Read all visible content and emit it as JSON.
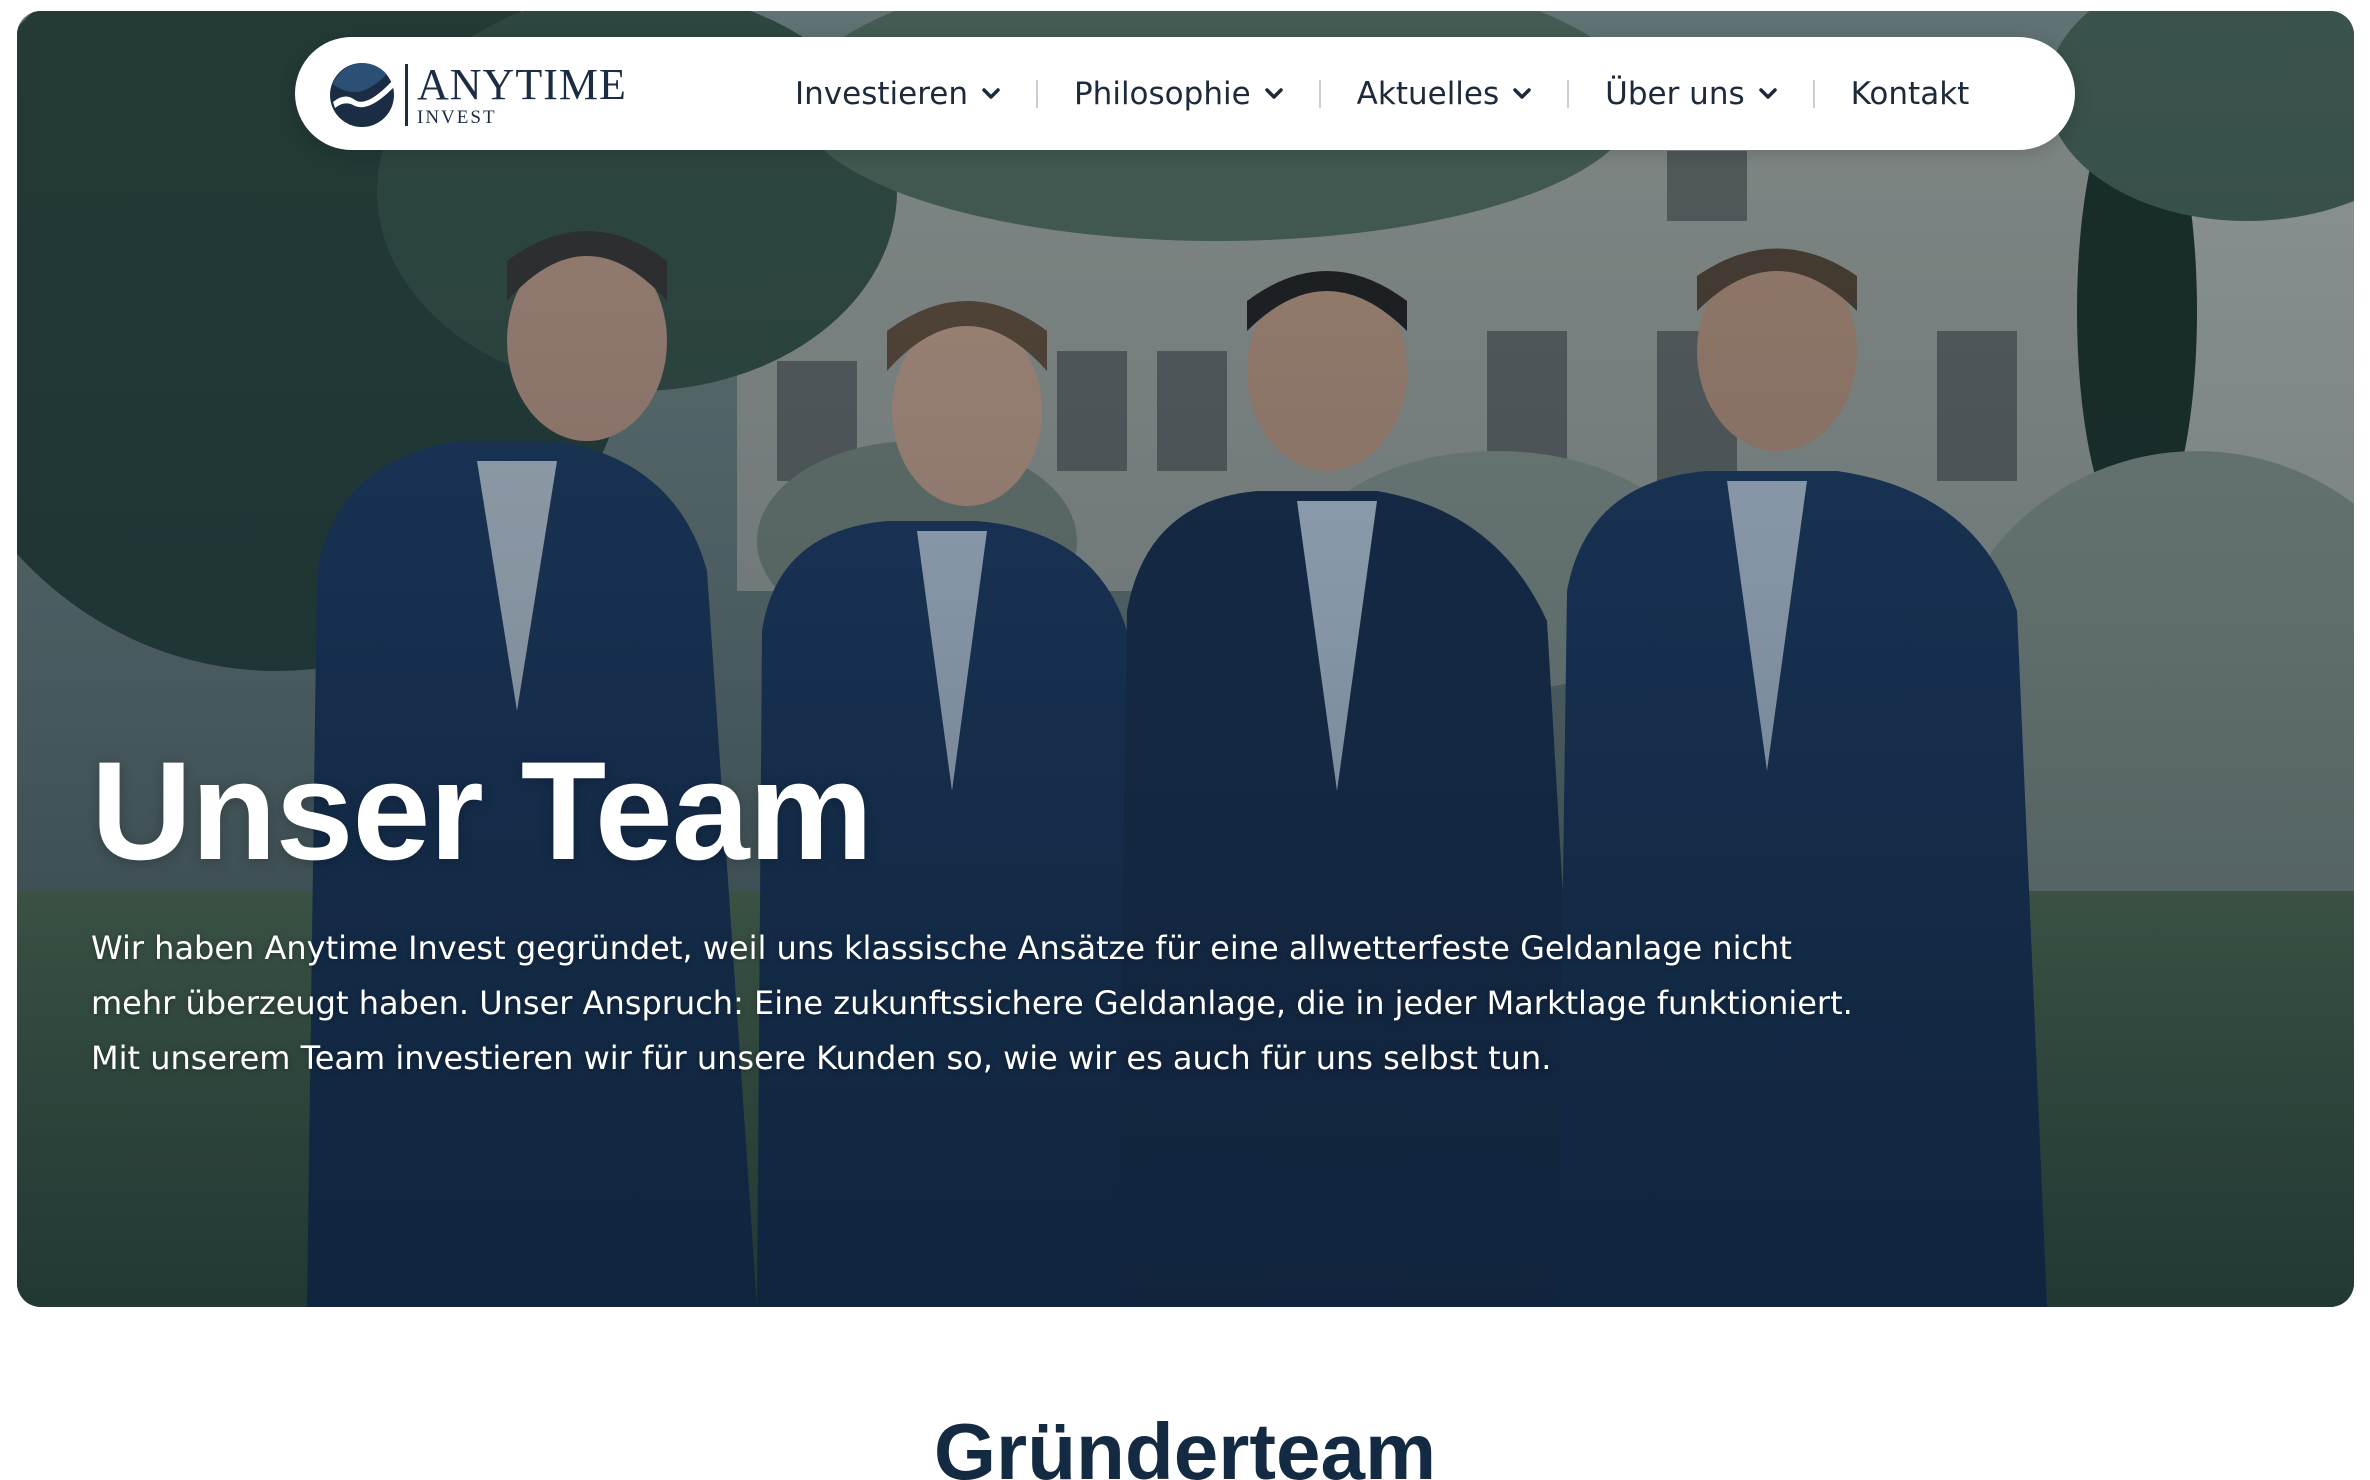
{
  "brand": {
    "name": "ANYTIME",
    "sub": "INVEST",
    "colors": {
      "navy": "#1b2d44",
      "accent": "#2f6fae"
    }
  },
  "nav": {
    "items": [
      {
        "label": "Investieren",
        "has_dropdown": true,
        "icon": "chevron-down-icon"
      },
      {
        "label": "Philosophie",
        "has_dropdown": true,
        "icon": "chevron-down-icon"
      },
      {
        "label": "Aktuelles",
        "has_dropdown": true,
        "icon": "chevron-down-icon"
      },
      {
        "label": "Über uns",
        "has_dropdown": true,
        "icon": "chevron-down-icon"
      },
      {
        "label": "Kontakt",
        "has_dropdown": false
      }
    ]
  },
  "hero": {
    "title": "Unser Team",
    "text": "Wir haben Anytime Invest gegründet, weil uns klassische Ansätze für eine allwetterfeste Geldanlage nicht mehr überzeugt haben. Unser Anspruch: Eine zukunftssichere Geldanlage, die in jeder Marktlage funktioniert. Mit unserem Team investieren wir für unsere Kunden so, wie wir es auch für uns selbst tun."
  },
  "section": {
    "title": "Gründerteam"
  }
}
